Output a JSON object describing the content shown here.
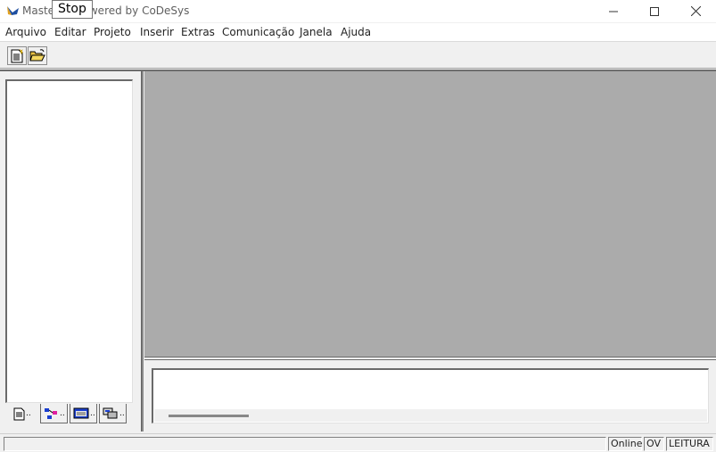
{
  "window": {
    "title": "Maste     C | powered by CoDeSys",
    "tooltip": "Stop",
    "controls": {
      "minimize_icon": "minimize-icon",
      "maximize_icon": "maximize-icon",
      "close_icon": "close-icon"
    }
  },
  "menu": {
    "items": [
      "Arquivo",
      "Editar",
      "Projeto",
      "Inserir",
      "Extras",
      "Comunicação",
      "Janela",
      "Ajuda"
    ]
  },
  "toolbar": {
    "buttons": [
      {
        "icon": "new-document-icon"
      },
      {
        "icon": "open-folder-icon"
      }
    ]
  },
  "left_pane": {
    "tabs": [
      {
        "icon": "pous-icon",
        "label": ".."
      },
      {
        "icon": "data-types-icon",
        "label": ".."
      },
      {
        "icon": "visualizations-icon",
        "label": ".."
      },
      {
        "icon": "resources-icon",
        "label": ".."
      }
    ]
  },
  "status": {
    "main": "",
    "online": "Online",
    "ov": "OV",
    "mode": "LEITURA"
  },
  "colors": {
    "workspace": "#ababab",
    "titlebar": "#ffffff"
  }
}
